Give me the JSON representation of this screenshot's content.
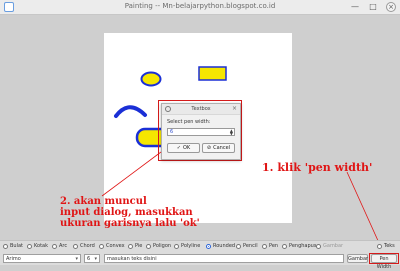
{
  "window": {
    "title": "Painting -- Mn-belajarpython.blogspot.co.id",
    "minimize": "—",
    "maximize": "□",
    "close": "×"
  },
  "dialog": {
    "title": "Textbox",
    "prompt": "Select pen width:",
    "value": "6",
    "ok_label": "OK",
    "cancel_label": "Cancel",
    "close": "×"
  },
  "annotations": {
    "step1": "1. klik 'pen width'",
    "step2_line1": "2. akan muncul",
    "step2_line2": "input dialog, masukkan",
    "step2_line3": "ukuran garisnya lalu 'ok'"
  },
  "tools": [
    {
      "label": "Bulat",
      "selected": false,
      "disabled": false
    },
    {
      "label": "Kotak",
      "selected": false,
      "disabled": false
    },
    {
      "label": "Arc",
      "selected": false,
      "disabled": false
    },
    {
      "label": "Chord",
      "selected": false,
      "disabled": false
    },
    {
      "label": "Convex",
      "selected": false,
      "disabled": false
    },
    {
      "label": "Pie",
      "selected": false,
      "disabled": false
    },
    {
      "label": "Poligon",
      "selected": false,
      "disabled": false
    },
    {
      "label": "Polyline",
      "selected": false,
      "disabled": false
    },
    {
      "label": "Rounded",
      "selected": true,
      "disabled": false
    },
    {
      "label": "Pencil",
      "selected": false,
      "disabled": false
    },
    {
      "label": "Pen",
      "selected": false,
      "disabled": false
    },
    {
      "label": "Penghapus",
      "selected": false,
      "disabled": false
    },
    {
      "label": "Gambar",
      "selected": false,
      "disabled": true
    },
    {
      "label": "Teks",
      "selected": false,
      "disabled": false
    }
  ],
  "bottom": {
    "font": "Arimo",
    "size": "6",
    "text_value": "masukan teks disini",
    "gambar_button": "Gambar",
    "pen_width_button": "Pen Width"
  },
  "colors": {
    "shape_fill": "#f5e600",
    "shape_stroke": "#1a2fd6",
    "annotation": "#e01515",
    "highlight": "#d51a1a"
  },
  "canvas_shapes": [
    {
      "name": "ellipse",
      "icon": "yellow-ellipse"
    },
    {
      "name": "rectangle",
      "icon": "yellow-rectangle"
    },
    {
      "name": "arc",
      "icon": "blue-arc"
    },
    {
      "name": "rounded-rect",
      "icon": "yellow-rounded-rect"
    }
  ]
}
